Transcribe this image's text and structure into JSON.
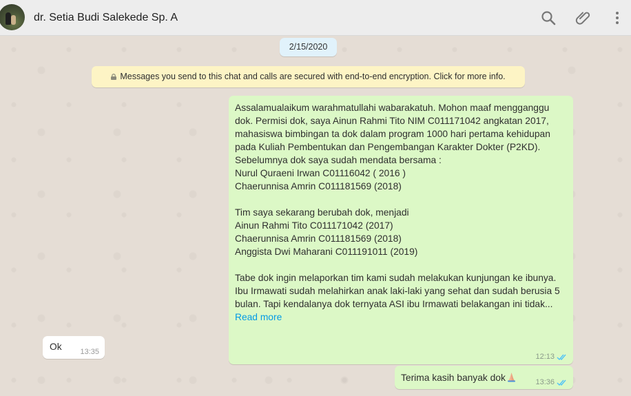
{
  "header": {
    "contact_name": "dr. Setia Budi Salekede Sp. A",
    "icons": [
      "search-icon",
      "attach-icon",
      "menu-icon"
    ]
  },
  "chat": {
    "date": "2/15/2020",
    "encryption_notice": "Messages you send to this chat and calls are secured with end-to-end encryption. Click for more info.",
    "messages": [
      {
        "direction": "outgoing",
        "text": "Assalamualaikum warahmatullahi wabarakatuh. Mohon maaf mengganggu dok. Permisi dok, saya Ainun Rahmi Tito NIM C011171042 angkatan 2017, mahasiswa bimbingan ta dok dalam program 1000 hari pertama kehidupan pada Kuliah Pembentukan dan Pengembangan Karakter Dokter (P2KD).\nSebelumnya dok saya sudah mendata bersama :\nNurul Quraeni Irwan C01116042 ( 2016 )\nChaerunnisa Amrin C011181569 (2018)\n\nTim saya sekarang berubah dok, menjadi\nAinun Rahmi Tito C011171042 (2017)\nChaerunnisa Amrin C011181569 (2018)\nAnggista Dwi Maharani C011191011 (2019)\n\nTabe dok ingin melaporkan tim kami sudah melakukan kunjungan ke ibunya. Ibu Irmawati sudah melahirkan anak laki-laki yang sehat dan sudah berusia 5 bulan. Tapi kendalanya dok ternyata ASI ibu Irmawati belakangan ini tidak...",
        "read_more": "Read more",
        "time": "12:13",
        "status": "read"
      },
      {
        "direction": "incoming",
        "text": "Ok",
        "time": "13:35"
      },
      {
        "direction": "outgoing",
        "text": "Terima kasih banyak dok",
        "emoji": "folded-hands",
        "time": "13:36",
        "status": "read"
      }
    ]
  },
  "colors": {
    "outgoing_bubble": "#dcf8c6",
    "incoming_bubble": "#ffffff",
    "read_ticks": "#4fc3f7",
    "link": "#039be5",
    "background": "#e5ddd5"
  }
}
